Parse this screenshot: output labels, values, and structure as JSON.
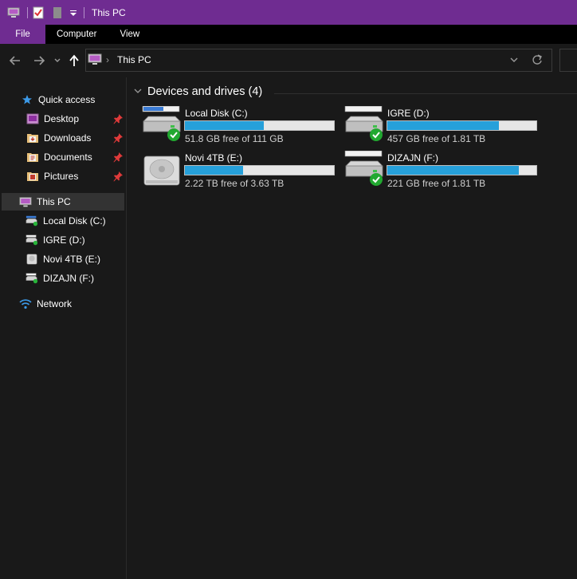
{
  "window": {
    "title": "This PC"
  },
  "ribbon": {
    "tabs": [
      "File",
      "Computer",
      "View"
    ]
  },
  "address": {
    "path": "This PC"
  },
  "sidebar": {
    "quick_access": "Quick access",
    "quick_items": [
      {
        "label": "Desktop",
        "icon": "desktop-folder-icon",
        "pinned": true
      },
      {
        "label": "Downloads",
        "icon": "downloads-folder-icon",
        "pinned": true
      },
      {
        "label": "Documents",
        "icon": "documents-folder-icon",
        "pinned": true
      },
      {
        "label": "Pictures",
        "icon": "pictures-folder-icon",
        "pinned": true
      }
    ],
    "this_pc": "This PC",
    "drives": [
      {
        "label": "Local Disk (C:)",
        "icon": "system-drive-icon"
      },
      {
        "label": "IGRE (D:)",
        "icon": "drive-icon"
      },
      {
        "label": "Novi 4TB (E:)",
        "icon": "hard-disk-icon"
      },
      {
        "label": "DIZAJN (F:)",
        "icon": "drive-icon"
      }
    ],
    "network": "Network"
  },
  "main": {
    "group_title": "Devices and drives (4)",
    "drives": [
      {
        "name": "Local Disk (C:)",
        "free": "51.8 GB free of 111 GB",
        "used_fraction": 0.53,
        "icon": "system-drive-icon"
      },
      {
        "name": "IGRE (D:)",
        "free": "457 GB free of 1.81 TB",
        "used_fraction": 0.75,
        "icon": "drive-icon"
      },
      {
        "name": "Novi 4TB (E:)",
        "free": "2.22 TB free of 3.63 TB",
        "used_fraction": 0.39,
        "icon": "hard-disk-icon"
      },
      {
        "name": "DIZAJN (F:)",
        "free": "221 GB free of 1.81 TB",
        "used_fraction": 0.88,
        "icon": "drive-icon"
      }
    ]
  },
  "colors": {
    "accent": "#6f2c91",
    "bar_fill": "#26a0da",
    "background": "#191919"
  }
}
